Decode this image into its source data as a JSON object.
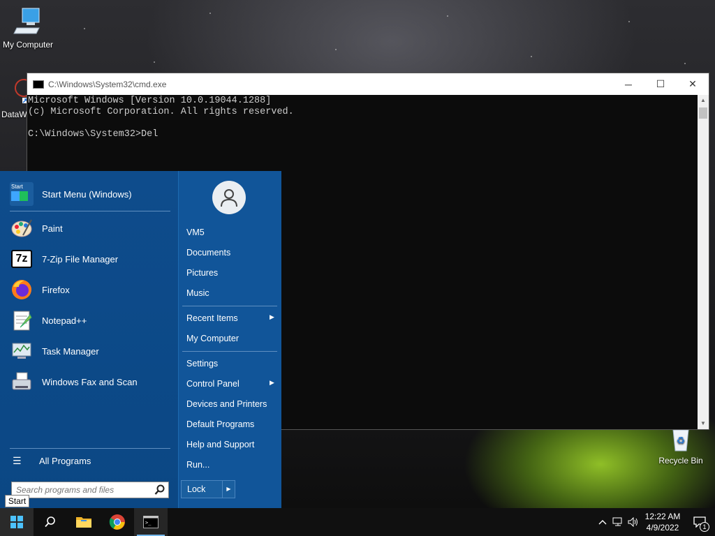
{
  "desktop": {
    "icons": [
      {
        "label": "My Computer",
        "icon": "monitor-icon"
      },
      {
        "label": "DataW",
        "icon": "app-shortcut-icon"
      },
      {
        "label": "Recycle Bin",
        "icon": "recycle-bin-icon"
      }
    ]
  },
  "cmd_window": {
    "title": "C:\\Windows\\System32\\cmd.exe",
    "lines": [
      "Microsoft Windows [Version 10.0.19044.1288]",
      "(c) Microsoft Corporation. All rights reserved.",
      "",
      "C:\\Windows\\System32>Del"
    ],
    "buttons": {
      "minimize": "─",
      "maximize": "☐",
      "close": "✕"
    }
  },
  "start_menu": {
    "header": {
      "label": "Start Menu (Windows)",
      "icon_text": "Start"
    },
    "programs": [
      {
        "label": "Paint",
        "icon": "paint-icon"
      },
      {
        "label": "7-Zip File Manager",
        "icon": "7zip-icon",
        "icon_text": "7z"
      },
      {
        "label": "Firefox",
        "icon": "firefox-icon"
      },
      {
        "label": "Notepad++",
        "icon": "notepadpp-icon"
      },
      {
        "label": "Task Manager",
        "icon": "task-manager-icon"
      },
      {
        "label": "Windows Fax and Scan",
        "icon": "fax-icon"
      }
    ],
    "all_programs": "All Programs",
    "search_placeholder": "Search programs and files",
    "right": {
      "user": "VM5",
      "group1": [
        "Documents",
        "Pictures",
        "Music"
      ],
      "group2": [
        {
          "label": "Recent Items",
          "submenu": true
        },
        {
          "label": "My Computer",
          "submenu": false
        }
      ],
      "group3": [
        {
          "label": "Settings",
          "submenu": false
        },
        {
          "label": "Control Panel",
          "submenu": true
        },
        {
          "label": "Devices and Printers",
          "submenu": false
        },
        {
          "label": "Default Programs",
          "submenu": false
        },
        {
          "label": "Help and Support",
          "submenu": false
        },
        {
          "label": "Run...",
          "submenu": false
        }
      ],
      "lock": "Lock"
    }
  },
  "tooltip": "Start",
  "taskbar": {
    "time": "12:22 AM",
    "date": "4/9/2022",
    "notification_count": "1"
  },
  "colors": {
    "start_menu_bg": "#0f4f8e",
    "taskbar_bg": "#101010",
    "accent": "#76b9ed"
  }
}
